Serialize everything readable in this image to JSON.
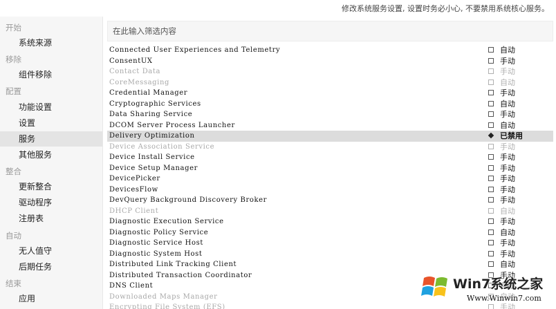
{
  "notice": "修改系统服务设置, 设置时务必小心, 不要禁用系统核心服务。",
  "sidebar": {
    "groups": {
      "start": "开始",
      "remove": "移除",
      "config": "配置",
      "integrate": "整合",
      "auto": "自动",
      "finish": "结束"
    },
    "items": {
      "system_source": "系统来源",
      "component_removal": "组件移除",
      "feature_settings": "功能设置",
      "settings": "设置",
      "services": "服务",
      "other_services": "其他服务",
      "update_integration": "更新整合",
      "drivers": "驱动程序",
      "registry": "注册表",
      "unattended": "无人值守",
      "post_tasks": "后期任务",
      "apply": "应用"
    }
  },
  "search": {
    "placeholder": "在此输入筛选内容"
  },
  "services": [
    {
      "name": "Connected User Experiences and Telemetry",
      "status": "自动",
      "disabled": false,
      "selected": false
    },
    {
      "name": "ConsentUX",
      "status": "手动",
      "disabled": false,
      "selected": false
    },
    {
      "name": "Contact Data",
      "status": "手动",
      "disabled": true,
      "selected": false
    },
    {
      "name": "CoreMessaging",
      "status": "自动",
      "disabled": true,
      "selected": false
    },
    {
      "name": "Credential Manager",
      "status": "手动",
      "disabled": false,
      "selected": false
    },
    {
      "name": "Cryptographic Services",
      "status": "自动",
      "disabled": false,
      "selected": false
    },
    {
      "name": "Data Sharing Service",
      "status": "手动",
      "disabled": false,
      "selected": false
    },
    {
      "name": "DCOM Server Process Launcher",
      "status": "自动",
      "disabled": false,
      "selected": false
    },
    {
      "name": "Delivery Optimization",
      "status": "已禁用",
      "disabled": false,
      "selected": true
    },
    {
      "name": "Device Association Service",
      "status": "手动",
      "disabled": true,
      "selected": false
    },
    {
      "name": "Device Install Service",
      "status": "手动",
      "disabled": false,
      "selected": false
    },
    {
      "name": "Device Setup Manager",
      "status": "手动",
      "disabled": false,
      "selected": false
    },
    {
      "name": "DevicePicker",
      "status": "手动",
      "disabled": false,
      "selected": false
    },
    {
      "name": "DevicesFlow",
      "status": "手动",
      "disabled": false,
      "selected": false
    },
    {
      "name": "DevQuery Background Discovery Broker",
      "status": "手动",
      "disabled": false,
      "selected": false
    },
    {
      "name": "DHCP Client",
      "status": "自动",
      "disabled": true,
      "selected": false
    },
    {
      "name": "Diagnostic Execution Service",
      "status": "手动",
      "disabled": false,
      "selected": false
    },
    {
      "name": "Diagnostic Policy Service",
      "status": "自动",
      "disabled": false,
      "selected": false
    },
    {
      "name": "Diagnostic Service Host",
      "status": "手动",
      "disabled": false,
      "selected": false
    },
    {
      "name": "Diagnostic System Host",
      "status": "手动",
      "disabled": false,
      "selected": false
    },
    {
      "name": "Distributed Link Tracking Client",
      "status": "自动",
      "disabled": false,
      "selected": false
    },
    {
      "name": "Distributed Transaction Coordinator",
      "status": "手动",
      "disabled": false,
      "selected": false
    },
    {
      "name": "DNS Client",
      "status": "自动",
      "disabled": false,
      "selected": false
    },
    {
      "name": "Downloaded Maps Manager",
      "status": "自动",
      "disabled": true,
      "selected": false
    },
    {
      "name": "Encrypting File System (EFS)",
      "status": "手动",
      "disabled": true,
      "selected": false
    }
  ],
  "watermark": {
    "title": "Win7系统之家",
    "url": "Www.Winwin7.com"
  }
}
